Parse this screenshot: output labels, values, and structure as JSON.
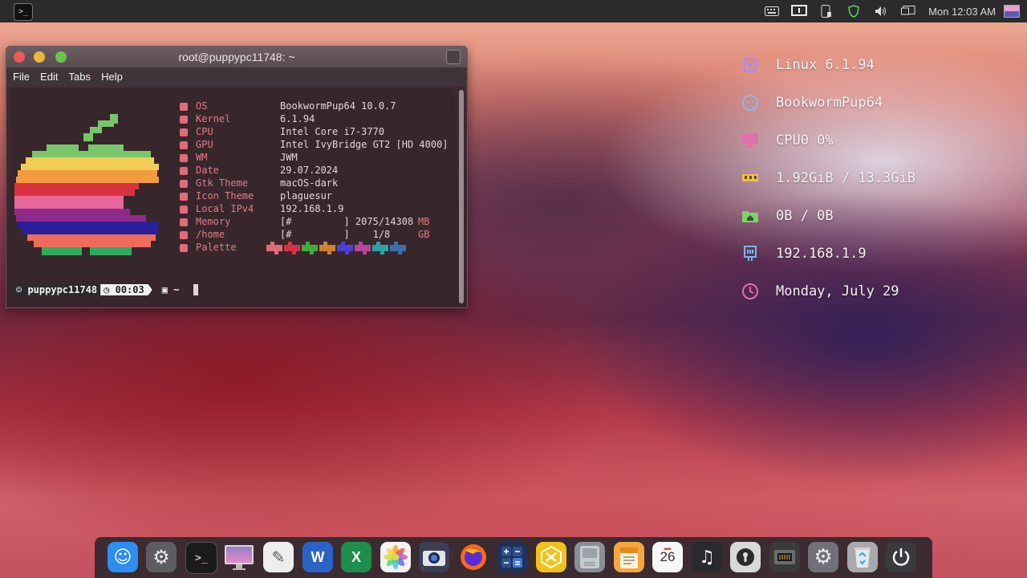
{
  "topbar": {
    "launcher_glyph": ">_",
    "clock": "Mon 12:03 AM",
    "tray_icons": [
      "keyboard-icon",
      "display-icon",
      "phone-icon",
      "shield-icon",
      "volume-icon",
      "network-icon",
      "flag-icon"
    ]
  },
  "terminal": {
    "title": "root@puppypc11748: ~",
    "menu": [
      "File",
      "Edit",
      "Tabs",
      "Help"
    ],
    "info": [
      {
        "label": "OS",
        "value": "BookwormPup64 10.0.7"
      },
      {
        "label": "Kernel",
        "value": "6.1.94"
      },
      {
        "label": "CPU",
        "value": "Intel Core i7-3770"
      },
      {
        "label": "GPU",
        "value": "Intel IvyBridge GT2 [HD 4000]"
      },
      {
        "label": "WM",
        "value": "JWM"
      },
      {
        "label": "Date",
        "value": "29.07.2024"
      },
      {
        "label": "Gtk Theme",
        "value": "macOS-dark"
      },
      {
        "label": "Icon Theme",
        "value": "plaguesur"
      },
      {
        "label": "Local IPv4",
        "value": "192.168.1.9"
      },
      {
        "label": "Memory",
        "value": "[#         ] 2075/14308",
        "unit": "MB"
      },
      {
        "label": "/home",
        "value": "[#         ]    1/8   ",
        "unit": "GB"
      },
      {
        "label": "Palette",
        "value": ""
      }
    ],
    "palette": [
      "#e06c75",
      "#d6304a",
      "#3fae3a",
      "#d1822a",
      "#4b3fd6",
      "#b8459c",
      "#2aa3a3",
      "#3d6fae"
    ],
    "prompt": {
      "user": "puppypc11748",
      "time": "00:03",
      "dir": "~"
    }
  },
  "conky": [
    {
      "icon": "cpu-chip-icon",
      "text": "Linux 6.1.94",
      "color": "#b08ae8"
    },
    {
      "icon": "puppy-icon",
      "text": "BookwormPup64",
      "color": "#8fb6e6"
    },
    {
      "icon": "monitor-icon",
      "text": "CPU0 0%",
      "color": "#e070a8"
    },
    {
      "icon": "memory-icon",
      "text": "1.92GiB / 13.3GiB",
      "color": "#f0c04c"
    },
    {
      "icon": "folder-home-icon",
      "text": "0B / 0B",
      "color": "#7ed26a"
    },
    {
      "icon": "ethernet-icon",
      "text": "192.168.1.9",
      "color": "#78b7e6"
    },
    {
      "icon": "clock-icon",
      "text": "Monday, July 29",
      "color": "#e070a8"
    }
  ],
  "dock": {
    "apps": [
      {
        "name": "finder",
        "color": "#2d8df1",
        "glyph": "☺"
      },
      {
        "name": "settings",
        "color": "#5c5c61",
        "glyph": "⚙"
      },
      {
        "name": "terminal",
        "color": "#1b1b1b",
        "glyph": ">_"
      },
      {
        "name": "display",
        "color": "#c9b3e5",
        "glyph": "▭"
      },
      {
        "name": "text-editor",
        "color": "#eeeeee",
        "glyph": "✎"
      },
      {
        "name": "word",
        "color": "#2b63c4",
        "glyph": "W"
      },
      {
        "name": "excel",
        "color": "#1d8e4b",
        "glyph": "X"
      },
      {
        "name": "photos",
        "color": "#f3f3f3",
        "glyph": "✿"
      },
      {
        "name": "screenshot",
        "color": "#3a3f52",
        "glyph": "◉"
      },
      {
        "name": "firefox",
        "color": "#f56a1f",
        "glyph": "◕"
      },
      {
        "name": "calculator",
        "color": "#1e3158",
        "glyph": "±"
      },
      {
        "name": "xarchiver",
        "color": "#f2c21a",
        "glyph": "✕"
      },
      {
        "name": "disks",
        "color": "#8a8f95",
        "glyph": "▤"
      },
      {
        "name": "notes",
        "color": "#f5a640",
        "glyph": "▦"
      },
      {
        "name": "calendar",
        "color": "#f7f7f7",
        "glyph": "26"
      },
      {
        "name": "music",
        "color": "#2a2a2e",
        "glyph": "♫"
      },
      {
        "name": "lock",
        "color": "#d9d9d9",
        "glyph": "⚿"
      },
      {
        "name": "network",
        "color": "#3a3a3a",
        "glyph": "▥"
      },
      {
        "name": "system-settings",
        "color": "#707079",
        "glyph": "⚙"
      },
      {
        "name": "trash",
        "color": "#a9a9ad",
        "glyph": "♻"
      },
      {
        "name": "shutdown",
        "color": "#3a3a3e",
        "glyph": "⏻"
      }
    ]
  }
}
